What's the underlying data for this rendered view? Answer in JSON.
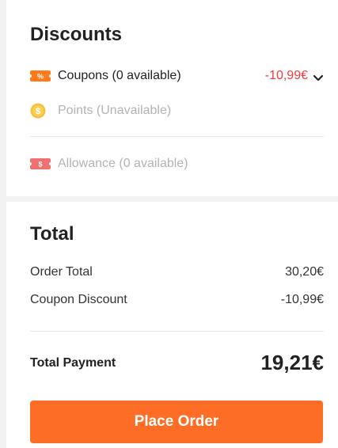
{
  "discounts": {
    "title": "Discounts",
    "coupons": {
      "label": "Coupons (0 available)",
      "amount": "-10,99€"
    },
    "points": {
      "label": "Points (Unavailable)"
    },
    "allowance": {
      "label": "Allowance (0 available)"
    }
  },
  "total": {
    "title": "Total",
    "order_total_label": "Order Total",
    "order_total_value": "30,20€",
    "coupon_discount_label": "Coupon Discount",
    "coupon_discount_value": "-10,99€",
    "payment_label": "Total Payment",
    "payment_value": "19,21€"
  },
  "actions": {
    "place_order_label": "Place Order"
  },
  "icons": {
    "coupon": "coupon-ticket-icon",
    "points": "gold-coin-icon",
    "allowance": "allowance-ticket-icon",
    "expand": "chevron-down-icon"
  },
  "colors": {
    "accent": "#fd6d25",
    "discount_red": "#ef3b3b",
    "muted_text": "#b3b3b3"
  }
}
